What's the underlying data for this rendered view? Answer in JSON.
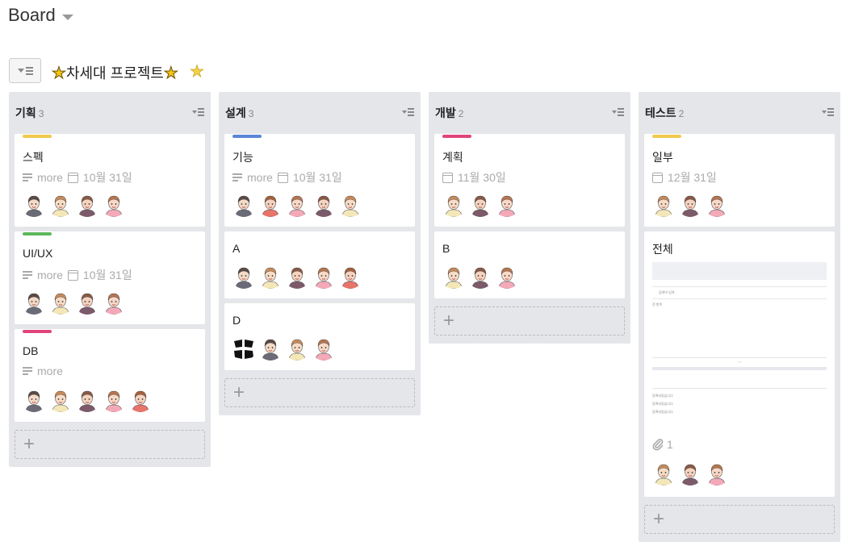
{
  "header": {
    "board_title": "Board"
  },
  "project": {
    "title": "차세대 프로젝트"
  },
  "colors": {
    "yellow": "#f2c94c",
    "green": "#5cb85c",
    "pink": "#e0447a",
    "blue": "#5b86d6",
    "column_bg": "#e5e6ea"
  },
  "columns": [
    {
      "name": "기획",
      "count": "3",
      "cards": [
        {
          "title": "스펙",
          "desc": "more",
          "date": "10월 31일"
        },
        {
          "title": "UI/UX",
          "desc": "more",
          "date": "10월 31일"
        },
        {
          "title": "DB",
          "desc": "more"
        }
      ]
    },
    {
      "name": "설계",
      "count": "3",
      "cards": [
        {
          "title": "기능",
          "desc": "more",
          "date": "10월 31일"
        },
        {
          "title": "A"
        },
        {
          "title": "D"
        }
      ]
    },
    {
      "name": "개발",
      "count": "2",
      "cards": [
        {
          "title": "계획",
          "date": "11월 30일"
        },
        {
          "title": "B"
        }
      ]
    },
    {
      "name": "테스트",
      "count": "2",
      "cards": [
        {
          "title": "일부",
          "date": "12월 31일"
        },
        {
          "title": "전체",
          "attachments": "1",
          "preview_texts": [
            "검색어 입력",
            "전 항목",
            "등록되었습니다",
            "등록되었습니다",
            "등록되었습니다"
          ]
        }
      ]
    }
  ]
}
